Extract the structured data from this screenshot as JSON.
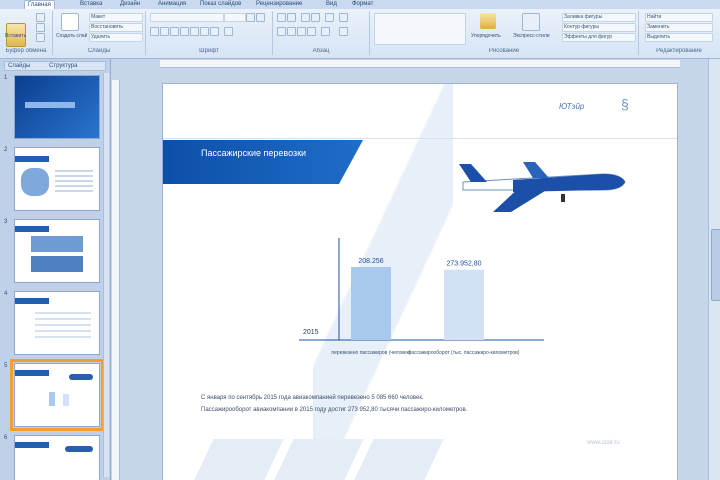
{
  "ribbon": {
    "tabs": [
      {
        "label": "Главная",
        "active": true
      },
      {
        "label": "Вставка"
      },
      {
        "label": "Дизайн"
      },
      {
        "label": "Анимация"
      },
      {
        "label": "Показ слайдов"
      },
      {
        "label": "Рецензирование"
      },
      {
        "label": "Вид"
      },
      {
        "label": "Формат"
      }
    ],
    "groups": [
      {
        "label": "Буфер обмена"
      },
      {
        "label": "Слайды"
      },
      {
        "label": "Шрифт"
      },
      {
        "label": "Абзац"
      },
      {
        "label": "Рисование"
      },
      {
        "label": "Редактирование"
      }
    ],
    "paste_label": "Вставить",
    "new_slide_label": "Создать слайд",
    "layout_label": "Макет",
    "reset_label": "Восстановить",
    "delete_label": "Удалить",
    "arrange_label": "Упорядочить",
    "quick_styles_label": "Экспресс-стили",
    "shape_fill_label": "Заливка фигуры",
    "shape_outline_label": "Контур фигуры",
    "shape_effects_label": "Эффекты для фигур",
    "find_label": "Найти",
    "replace_label": "Заменить",
    "select_label": "Выделить"
  },
  "thumbnails": {
    "tabs": [
      "Слайды",
      "Структура"
    ],
    "items": [
      {
        "number": "1"
      },
      {
        "number": "2"
      },
      {
        "number": "3"
      },
      {
        "number": "4"
      },
      {
        "number": "5",
        "active": true
      },
      {
        "number": "6"
      }
    ]
  },
  "slide": {
    "title": "Пассажирские перевозки",
    "logo_text": "ЮТэйр",
    "bullets": [
      "С января по сентябрь 2015 года авиакомпанией перевезено 5 085 660 человек.",
      "Пассажирооборот авиакомпании в 2015 году достиг 273 952,80 тысячи пассажиро-километров."
    ],
    "url": "www.utair.ru"
  },
  "chart_data": {
    "type": "bar",
    "categories": [
      "перевезено пассажиров (человек)",
      "пассажирооборот (тыс. пассажиро-километров)"
    ],
    "values": [
      208.256,
      273.952
    ],
    "value_labels": [
      "208.256",
      "273.952,80"
    ],
    "year_label": "2015",
    "colors": [
      "#a9c8ee",
      "#d2e2f4"
    ]
  }
}
